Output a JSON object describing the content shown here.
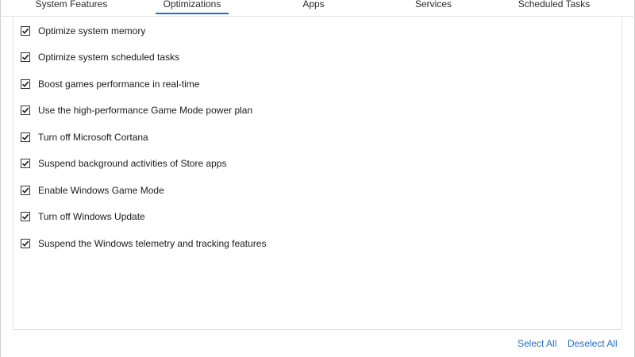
{
  "tabs": [
    {
      "label": "System Features",
      "active": false
    },
    {
      "label": "Optimizations",
      "active": true
    },
    {
      "label": "Apps",
      "active": false
    },
    {
      "label": "Services",
      "active": false
    },
    {
      "label": "Scheduled Tasks",
      "active": false
    }
  ],
  "options": [
    {
      "label": "Optimize system memory",
      "checked": true
    },
    {
      "label": "Optimize system scheduled tasks",
      "checked": true
    },
    {
      "label": "Boost games performance in real-time",
      "checked": true
    },
    {
      "label": "Use the high-performance Game Mode power plan",
      "checked": true
    },
    {
      "label": "Turn off Microsoft Cortana",
      "checked": true
    },
    {
      "label": "Suspend background activities of Store apps",
      "checked": true
    },
    {
      "label": "Enable Windows Game Mode",
      "checked": true
    },
    {
      "label": "Turn off Windows Update",
      "checked": true
    },
    {
      "label": "Suspend the Windows telemetry and tracking features",
      "checked": true
    }
  ],
  "footer": {
    "select_all": "Select All",
    "deselect_all": "Deselect All"
  },
  "colors": {
    "accent": "#1f6fc4",
    "checkmark": "#1a1a1a"
  }
}
